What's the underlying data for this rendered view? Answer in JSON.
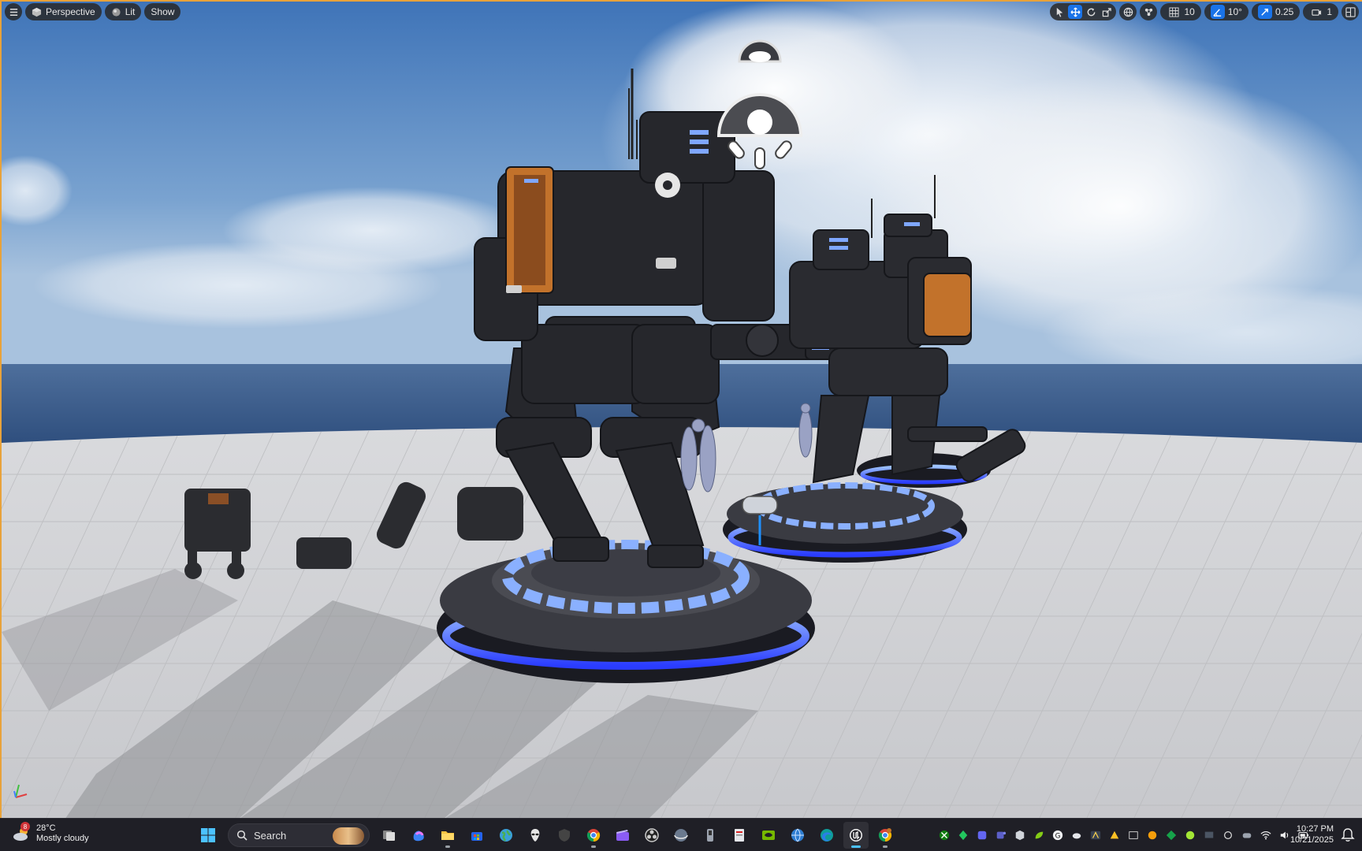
{
  "viewport": {
    "menu_icon": "hamburger-icon",
    "view_mode": "Perspective",
    "lighting_mode": "Lit",
    "show_label": "Show",
    "grid_snap": "10",
    "rotation_snap": "10°",
    "scale_snap": "0.25",
    "camera_speed": "1",
    "accent": "#1a73e8",
    "border_color": "#e8a23a"
  },
  "taskbar": {
    "weather": {
      "temperature": "28°C",
      "condition": "Mostly cloudy",
      "badge": "8"
    },
    "search_placeholder": "Search",
    "clock": {
      "time": "10:27 PM",
      "date": "10/21/2025"
    }
  }
}
